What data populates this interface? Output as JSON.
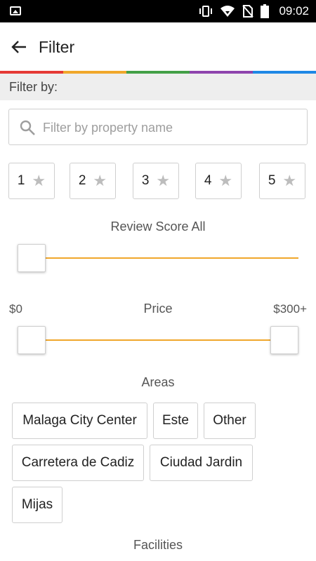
{
  "status_bar": {
    "time": "09:02",
    "icons": [
      "image-icon",
      "vibrate-icon",
      "wifi-icon",
      "no-sim-icon",
      "battery-icon"
    ]
  },
  "app_bar": {
    "title": "Filter",
    "back_icon": "arrow-left-icon"
  },
  "accent_stripes": [
    "#e53935",
    "#f0a72b",
    "#43a047",
    "#8e44ad",
    "#1e88e5"
  ],
  "filter_section": {
    "header": "Filter by:",
    "search": {
      "placeholder": "Filter by property name",
      "value": ""
    },
    "star_ratings": [
      {
        "label": "1",
        "icon": "star-icon"
      },
      {
        "label": "2",
        "icon": "star-icon"
      },
      {
        "label": "3",
        "icon": "star-icon"
      },
      {
        "label": "4",
        "icon": "star-icon"
      },
      {
        "label": "5",
        "icon": "star-icon"
      }
    ],
    "review_score": {
      "label": "Review Score All",
      "value_fraction": 0
    },
    "price": {
      "label": "Price",
      "min_label": "$0",
      "max_label": "$300+",
      "low_fraction": 0,
      "high_fraction": 1
    },
    "areas": {
      "label": "Areas",
      "items": [
        "Malaga City Center",
        "Este",
        "Other",
        "Carretera de Cadiz",
        "Ciudad Jardin",
        "Mijas"
      ]
    },
    "facilities": {
      "label": "Facilities"
    }
  },
  "colors": {
    "slider_track": "#f0a72b",
    "section_header_bg": "#eeeeee"
  }
}
